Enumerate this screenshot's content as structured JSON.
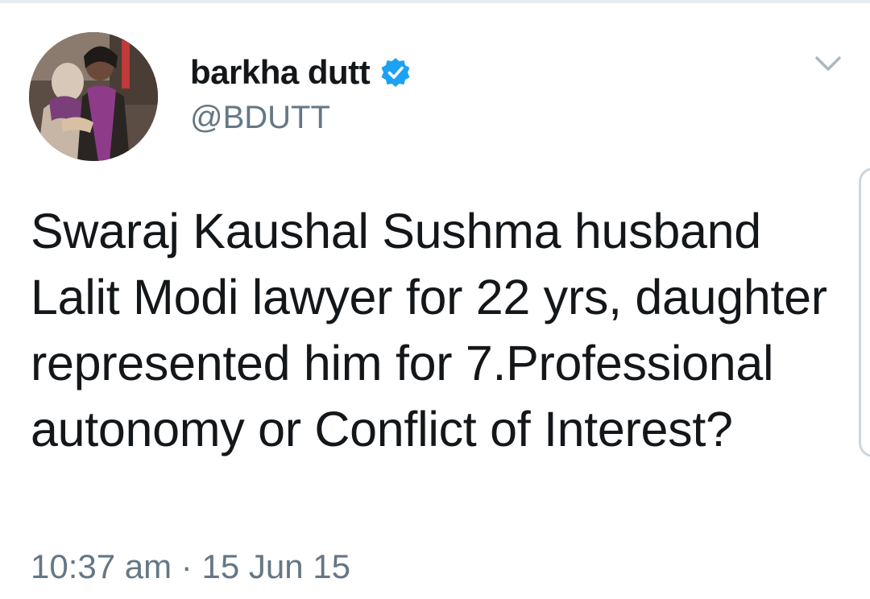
{
  "tweet": {
    "author": {
      "display_name": "barkha dutt",
      "handle": "@BDUTT",
      "verified": true,
      "avatar": "profile-photo"
    },
    "text": "Swaraj Kaushal Sushma husband Lalit Modi lawyer for 22 yrs, daughter represented him for 7.Professional autonomy or Conflict of Interest?",
    "time": "10:37 am",
    "separator": "·",
    "date": "15 Jun 15",
    "menu_icon": "chevron-down-icon",
    "verified_icon": "verified-badge-icon"
  },
  "colors": {
    "text_primary": "#14171a",
    "text_secondary": "#657786",
    "verified_blue": "#1da1f2",
    "chevron": "#aab8c2"
  }
}
